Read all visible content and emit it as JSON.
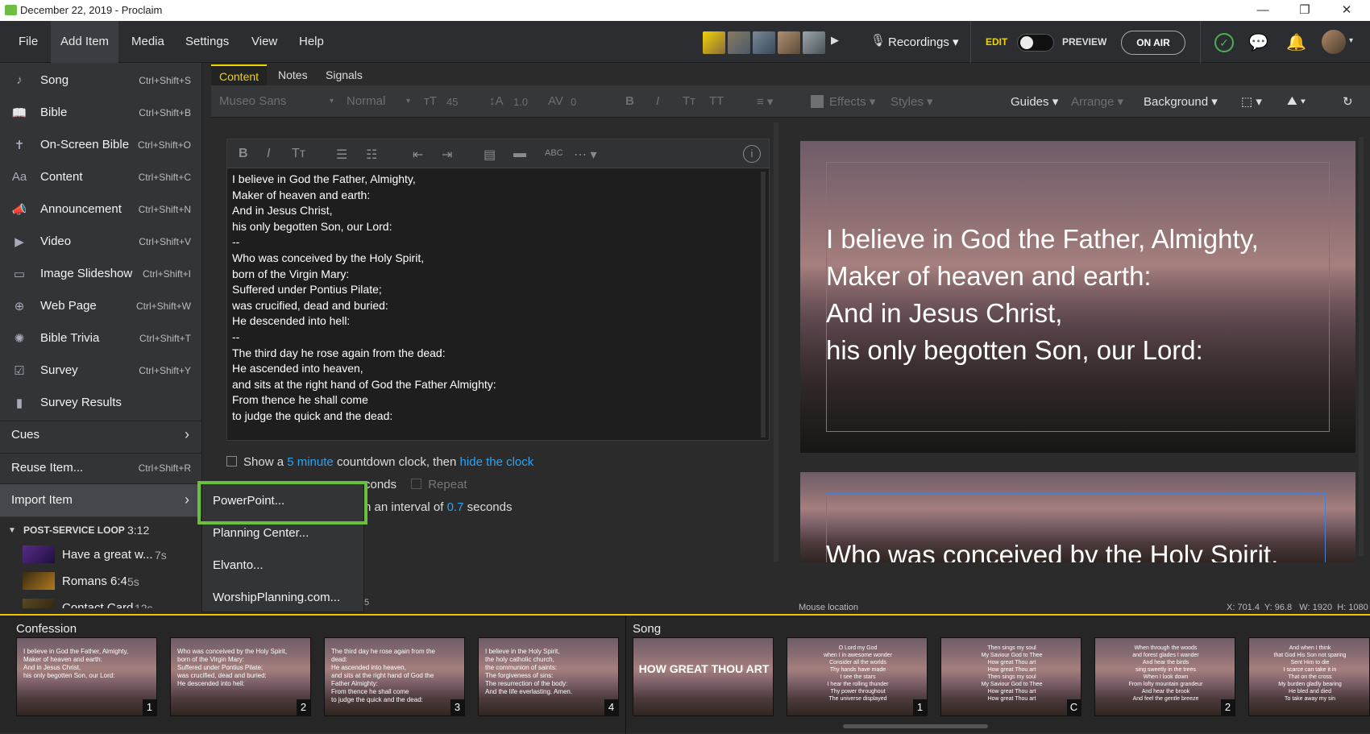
{
  "window": {
    "title": "December 22, 2019 - Proclaim",
    "min": "—",
    "max": "❐",
    "close": "✕"
  },
  "menubar": {
    "items": [
      "File",
      "Add Item",
      "Media",
      "Settings",
      "View",
      "Help"
    ],
    "recordings": "Recordings",
    "edit": "EDIT",
    "preview": "PREVIEW",
    "onair": "ON AIR"
  },
  "add_item_menu": [
    {
      "icon": "♪",
      "label": "Song",
      "shortcut": "Ctrl+Shift+S"
    },
    {
      "icon": "📖",
      "label": "Bible",
      "shortcut": "Ctrl+Shift+B"
    },
    {
      "icon": "✝",
      "label": "On-Screen Bible",
      "shortcut": "Ctrl+Shift+O"
    },
    {
      "icon": "Aa",
      "label": "Content",
      "shortcut": "Ctrl+Shift+C"
    },
    {
      "icon": "📣",
      "label": "Announcement",
      "shortcut": "Ctrl+Shift+N"
    },
    {
      "icon": "▶",
      "label": "Video",
      "shortcut": "Ctrl+Shift+V"
    },
    {
      "icon": "▭",
      "label": "Image Slideshow",
      "shortcut": "Ctrl+Shift+I"
    },
    {
      "icon": "⊕",
      "label": "Web Page",
      "shortcut": "Ctrl+Shift+W"
    },
    {
      "icon": "✺",
      "label": "Bible Trivia",
      "shortcut": "Ctrl+Shift+T"
    },
    {
      "icon": "☑",
      "label": "Survey",
      "shortcut": "Ctrl+Shift+Y"
    },
    {
      "icon": "▮",
      "label": "Survey Results",
      "shortcut": ""
    }
  ],
  "cues": "Cues",
  "reuse": {
    "label": "Reuse Item...",
    "shortcut": "Ctrl+Shift+R"
  },
  "import": "Import Item",
  "import_submenu": [
    "PowerPoint...",
    "Planning Center...",
    "Elvanto...",
    "WorshipPlanning.com..."
  ],
  "postloop": {
    "header": "POST-SERVICE LOOP",
    "duration": "3:12",
    "items": [
      {
        "label": "Have a great w...",
        "time": "7s"
      },
      {
        "label": "Romans 6:4",
        "time": "5s"
      },
      {
        "label": "Contact Card",
        "time": "12s"
      }
    ]
  },
  "tabs": [
    "Content",
    "Notes",
    "Signals"
  ],
  "format": {
    "font": "Museo Sans",
    "style": "Normal",
    "size": "45",
    "line": "1.0",
    "spacing": "0",
    "effects": "Effects",
    "styles": "Styles",
    "guides": "Guides",
    "arrange": "Arrange",
    "background": "Background"
  },
  "editor_text": "I believe in God the Father, Almighty,\nMaker of heaven and earth:\nAnd in Jesus Christ,\nhis only begotten Son, our Lord:\n--\nWho was conceived by the Holy Spirit,\nborn of the Virgin Mary:\nSuffered under Pontius Pilate;\nwas crucified, dead and buried:\nHe descended into hell:\n--\nThe third day he rose again from the dead:\nHe ascended into heaven,\nand sits at the right hand of God the Father Almighty:\nFrom thence he shall come\nto judge the quick and the dead:",
  "countdown": {
    "a": "Show a",
    "minutes": "5 minute",
    "b": "countdown clock, then",
    "hide": "hide the clock",
    "seconds_tail": "conds",
    "repeat": "Repeat",
    "interval_a": "n an interval of",
    "interval_val": "0.7",
    "interval_b": "seconds",
    "row4": "5"
  },
  "slide1_text": "I believe in God the Father, Almighty,\nMaker of heaven and earth:\nAnd in Jesus Christ,\nhis only begotten Son, our Lord:",
  "slide2_text": "Who was conceived by the Holy Spirit,",
  "status": {
    "mouse": "Mouse location",
    "coords": "X: 701.4  Y: 96.8   W: 1920  H: 1080"
  },
  "bottom": {
    "confession": "Confession",
    "song": "Song",
    "confession_thumbs": [
      {
        "text": "I believe in God the Father, Almighty,\nMaker of heaven and earth:\nAnd in Jesus Christ,\nhis only begotten Son, our Lord:",
        "num": "1"
      },
      {
        "text": "Who was conceived by the Holy Spirit,\nborn of the Virgin Mary:\nSuffered under Pontius Pilate;\nwas crucified, dead and buried:\nHe descended into hell:",
        "num": "2"
      },
      {
        "text": "The third day he rose again from the\ndead:\nHe ascended into heaven,\nand sits at the right hand of God the\nFather Almighty:\nFrom thence he shall come\nto judge the quick and the dead:",
        "num": "3"
      },
      {
        "text": "I believe in the Holy Spirit,\nthe holy catholic church,\nthe communion of saints:\nThe forgiveness of sins:\nThe resurrection of the body:\nAnd the life everlasting. Amen.",
        "num": "4"
      }
    ],
    "song_title": "HOW GREAT THOU ART",
    "song_thumbs": [
      {
        "text": "O Lord my God\nwhen I in awesome wonder\nConsider all the worlds\nThy hands have made\nI see the stars\nI hear the rolling thunder\nThy power throughout\nThe universe displayed",
        "num": "1"
      },
      {
        "text": "Then sings my soul\nMy Saviour God to Thee\nHow great Thou art\nHow great Thou art\nThen sings my soul\nMy Saviour God to Thee\nHow great Thou art\nHow great Thou art",
        "num": "C"
      },
      {
        "text": "When through the woods\nand forest glades I wander\nAnd hear the birds\nsing sweetly in the trees\nWhen I look down\nFrom lofty mountain grandeur\nAnd hear the brook\nAnd feel the gentle breeze",
        "num": "2"
      },
      {
        "text": "And when I think\nthat God His Son not sparing\nSent Him to die\nI scarce can take it in\nThat on the cross\nMy burden gladly bearing\nHe bled and died\nTo take away my sin",
        "num": ""
      }
    ]
  }
}
